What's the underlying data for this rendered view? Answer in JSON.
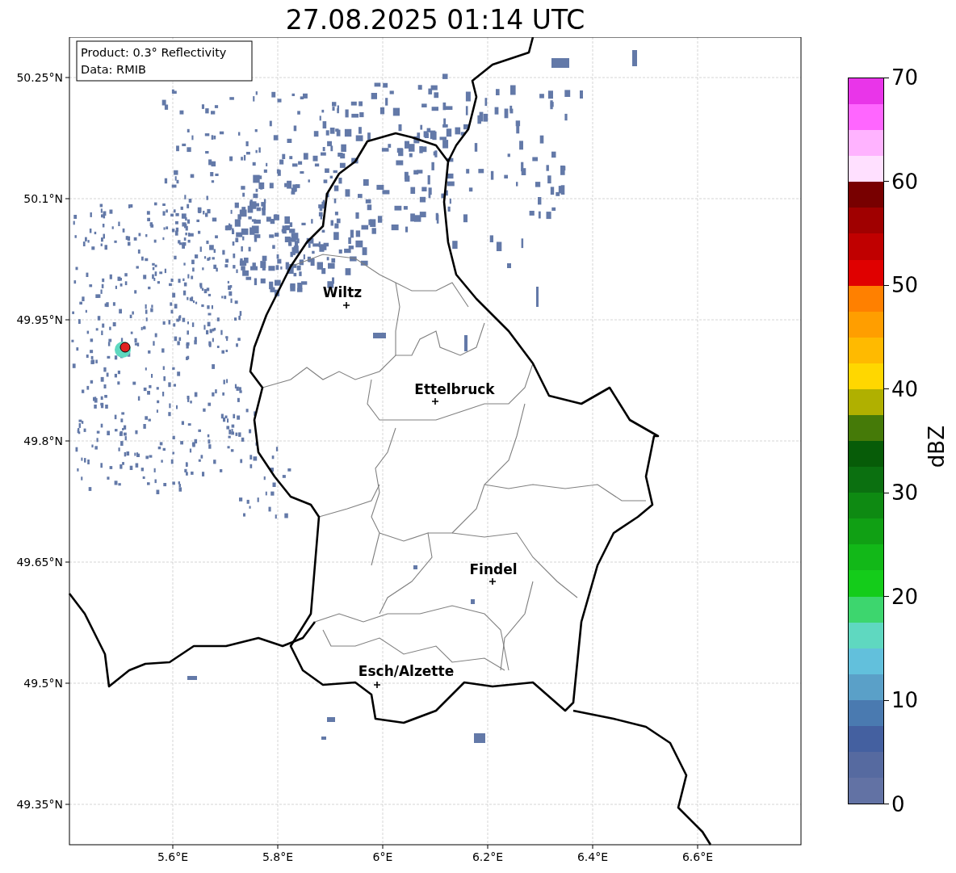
{
  "title": "27.08.2025 01:14 UTC",
  "map": {
    "info_box": [
      "Product: 0.3° Reflectivity",
      "Data: RMIB"
    ],
    "lat_ticks": [
      "50.25°N",
      "50.1°N",
      "49.95°N",
      "49.8°N",
      "49.65°N",
      "49.5°N",
      "49.35°N"
    ],
    "lon_ticks": [
      "5.6°E",
      "5.8°E",
      "6°E",
      "6.2°E",
      "6.4°E",
      "6.6°E"
    ],
    "cities": [
      {
        "name": "Wiltz"
      },
      {
        "name": "Ettelbruck"
      },
      {
        "name": "Findel"
      },
      {
        "name": "Esch/Alzette"
      }
    ]
  },
  "colorbar": {
    "label": "dBZ",
    "ticks": [
      "70",
      "60",
      "50",
      "40",
      "30",
      "20",
      "10",
      "0"
    ],
    "bands": [
      {
        "color": "#e935e9"
      },
      {
        "color": "#ff66ff"
      },
      {
        "color": "#ffb3ff"
      },
      {
        "color": "#ffe0ff"
      },
      {
        "color": "#780000"
      },
      {
        "color": "#a00000"
      },
      {
        "color": "#c00000"
      },
      {
        "color": "#e00000"
      },
      {
        "color": "#ff8000"
      },
      {
        "color": "#ff9e00"
      },
      {
        "color": "#ffba00"
      },
      {
        "color": "#ffd700"
      },
      {
        "color": "#b0b000"
      },
      {
        "color": "#457a08"
      },
      {
        "color": "#075c08"
      },
      {
        "color": "#0b7010"
      },
      {
        "color": "#0e8a12"
      },
      {
        "color": "#10a014"
      },
      {
        "color": "#12b818"
      },
      {
        "color": "#14cc1a"
      },
      {
        "color": "#3dd66e"
      },
      {
        "color": "#5fd8c0"
      },
      {
        "color": "#62c0dc"
      },
      {
        "color": "#5aa0c8"
      },
      {
        "color": "#4a7ab0"
      },
      {
        "color": "#4460a0"
      },
      {
        "color": "#566aa0"
      },
      {
        "color": "#6272a4"
      }
    ]
  }
}
